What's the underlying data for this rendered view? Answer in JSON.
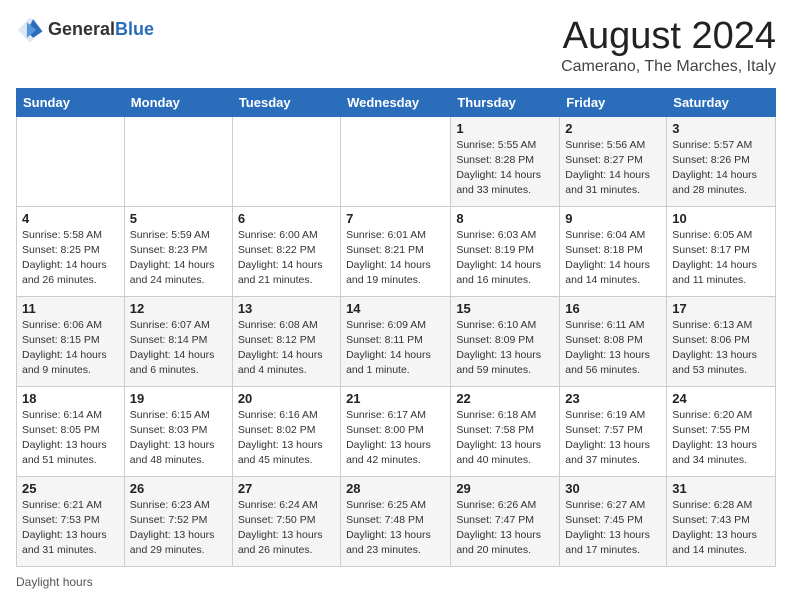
{
  "header": {
    "logo_general": "General",
    "logo_blue": "Blue",
    "month_year": "August 2024",
    "location": "Camerano, The Marches, Italy"
  },
  "weekdays": [
    "Sunday",
    "Monday",
    "Tuesday",
    "Wednesday",
    "Thursday",
    "Friday",
    "Saturday"
  ],
  "weeks": [
    [
      {
        "day": "",
        "info": ""
      },
      {
        "day": "",
        "info": ""
      },
      {
        "day": "",
        "info": ""
      },
      {
        "day": "",
        "info": ""
      },
      {
        "day": "1",
        "info": "Sunrise: 5:55 AM\nSunset: 8:28 PM\nDaylight: 14 hours and 33 minutes."
      },
      {
        "day": "2",
        "info": "Sunrise: 5:56 AM\nSunset: 8:27 PM\nDaylight: 14 hours and 31 minutes."
      },
      {
        "day": "3",
        "info": "Sunrise: 5:57 AM\nSunset: 8:26 PM\nDaylight: 14 hours and 28 minutes."
      }
    ],
    [
      {
        "day": "4",
        "info": "Sunrise: 5:58 AM\nSunset: 8:25 PM\nDaylight: 14 hours and 26 minutes."
      },
      {
        "day": "5",
        "info": "Sunrise: 5:59 AM\nSunset: 8:23 PM\nDaylight: 14 hours and 24 minutes."
      },
      {
        "day": "6",
        "info": "Sunrise: 6:00 AM\nSunset: 8:22 PM\nDaylight: 14 hours and 21 minutes."
      },
      {
        "day": "7",
        "info": "Sunrise: 6:01 AM\nSunset: 8:21 PM\nDaylight: 14 hours and 19 minutes."
      },
      {
        "day": "8",
        "info": "Sunrise: 6:03 AM\nSunset: 8:19 PM\nDaylight: 14 hours and 16 minutes."
      },
      {
        "day": "9",
        "info": "Sunrise: 6:04 AM\nSunset: 8:18 PM\nDaylight: 14 hours and 14 minutes."
      },
      {
        "day": "10",
        "info": "Sunrise: 6:05 AM\nSunset: 8:17 PM\nDaylight: 14 hours and 11 minutes."
      }
    ],
    [
      {
        "day": "11",
        "info": "Sunrise: 6:06 AM\nSunset: 8:15 PM\nDaylight: 14 hours and 9 minutes."
      },
      {
        "day": "12",
        "info": "Sunrise: 6:07 AM\nSunset: 8:14 PM\nDaylight: 14 hours and 6 minutes."
      },
      {
        "day": "13",
        "info": "Sunrise: 6:08 AM\nSunset: 8:12 PM\nDaylight: 14 hours and 4 minutes."
      },
      {
        "day": "14",
        "info": "Sunrise: 6:09 AM\nSunset: 8:11 PM\nDaylight: 14 hours and 1 minute."
      },
      {
        "day": "15",
        "info": "Sunrise: 6:10 AM\nSunset: 8:09 PM\nDaylight: 13 hours and 59 minutes."
      },
      {
        "day": "16",
        "info": "Sunrise: 6:11 AM\nSunset: 8:08 PM\nDaylight: 13 hours and 56 minutes."
      },
      {
        "day": "17",
        "info": "Sunrise: 6:13 AM\nSunset: 8:06 PM\nDaylight: 13 hours and 53 minutes."
      }
    ],
    [
      {
        "day": "18",
        "info": "Sunrise: 6:14 AM\nSunset: 8:05 PM\nDaylight: 13 hours and 51 minutes."
      },
      {
        "day": "19",
        "info": "Sunrise: 6:15 AM\nSunset: 8:03 PM\nDaylight: 13 hours and 48 minutes."
      },
      {
        "day": "20",
        "info": "Sunrise: 6:16 AM\nSunset: 8:02 PM\nDaylight: 13 hours and 45 minutes."
      },
      {
        "day": "21",
        "info": "Sunrise: 6:17 AM\nSunset: 8:00 PM\nDaylight: 13 hours and 42 minutes."
      },
      {
        "day": "22",
        "info": "Sunrise: 6:18 AM\nSunset: 7:58 PM\nDaylight: 13 hours and 40 minutes."
      },
      {
        "day": "23",
        "info": "Sunrise: 6:19 AM\nSunset: 7:57 PM\nDaylight: 13 hours and 37 minutes."
      },
      {
        "day": "24",
        "info": "Sunrise: 6:20 AM\nSunset: 7:55 PM\nDaylight: 13 hours and 34 minutes."
      }
    ],
    [
      {
        "day": "25",
        "info": "Sunrise: 6:21 AM\nSunset: 7:53 PM\nDaylight: 13 hours and 31 minutes."
      },
      {
        "day": "26",
        "info": "Sunrise: 6:23 AM\nSunset: 7:52 PM\nDaylight: 13 hours and 29 minutes."
      },
      {
        "day": "27",
        "info": "Sunrise: 6:24 AM\nSunset: 7:50 PM\nDaylight: 13 hours and 26 minutes."
      },
      {
        "day": "28",
        "info": "Sunrise: 6:25 AM\nSunset: 7:48 PM\nDaylight: 13 hours and 23 minutes."
      },
      {
        "day": "29",
        "info": "Sunrise: 6:26 AM\nSunset: 7:47 PM\nDaylight: 13 hours and 20 minutes."
      },
      {
        "day": "30",
        "info": "Sunrise: 6:27 AM\nSunset: 7:45 PM\nDaylight: 13 hours and 17 minutes."
      },
      {
        "day": "31",
        "info": "Sunrise: 6:28 AM\nSunset: 7:43 PM\nDaylight: 13 hours and 14 minutes."
      }
    ]
  ],
  "footer": {
    "note": "Daylight hours"
  }
}
